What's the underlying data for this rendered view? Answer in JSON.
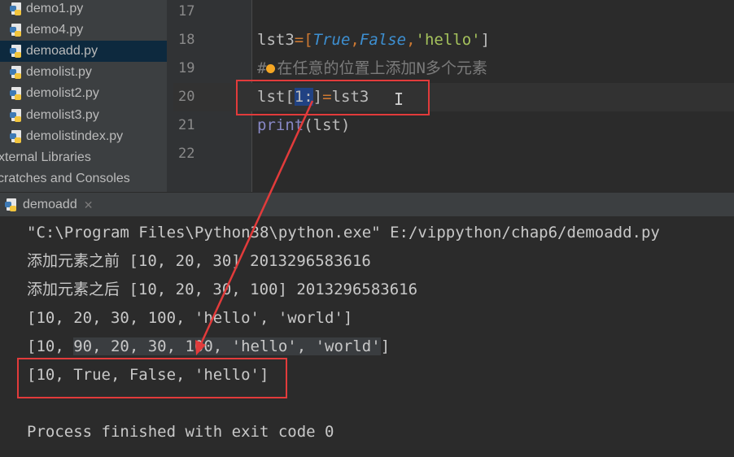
{
  "sidebar": {
    "items": [
      {
        "label": "demo1.py",
        "selected": false
      },
      {
        "label": "demo4.py",
        "selected": false
      },
      {
        "label": "demoadd.py",
        "selected": true
      },
      {
        "label": "demolist.py",
        "selected": false
      },
      {
        "label": "demolist2.py",
        "selected": false
      },
      {
        "label": "demolist3.py",
        "selected": false
      },
      {
        "label": "demolistindex.py",
        "selected": false
      }
    ],
    "external_libraries": "xternal Libraries",
    "scratches": "cratches and Consoles"
  },
  "editor": {
    "lines": [
      {
        "num": "17"
      },
      {
        "num": "18",
        "tokens": {
          "a": "lst3",
          "b": "=[",
          "c": "True",
          "d": ",",
          "e": "False",
          "f": ",",
          "g": "'hello'",
          "h": "]"
        }
      },
      {
        "num": "19",
        "tokens": {
          "hash": "#",
          "text": "在任意的位置上添加N多个元素"
        }
      },
      {
        "num": "20",
        "tokens": {
          "a": "lst[",
          "b": "1:",
          "c": "]",
          "d": "=",
          "e": "lst3"
        }
      },
      {
        "num": "21",
        "tokens": {
          "a": "print",
          "b": "(lst)"
        }
      },
      {
        "num": "22"
      }
    ]
  },
  "run": {
    "tab_label": "demoadd",
    "output": [
      "\"C:\\Program Files\\Python38\\python.exe\" E:/vippython/chap6/demoadd.py",
      "添加元素之前 [10, 20, 30] 2013296583616",
      "添加元素之后 [10, 20, 30, 100] 2013296583616",
      "[10, 20, 30, 100, 'hello', 'world']",
      "[10, 90, 20, 30, 100, 'hello', 'world']",
      "[10, True, False, 'hello']",
      "",
      "Process finished with exit code 0"
    ],
    "output_parts": {
      "line5_a": "[10, ",
      "line5_b": "90, 20, 30, 100, 'hello', 'world'",
      "line5_c": "]"
    }
  },
  "colors": {
    "annotation": "#e23b3b",
    "background": "#2b2b2b"
  }
}
